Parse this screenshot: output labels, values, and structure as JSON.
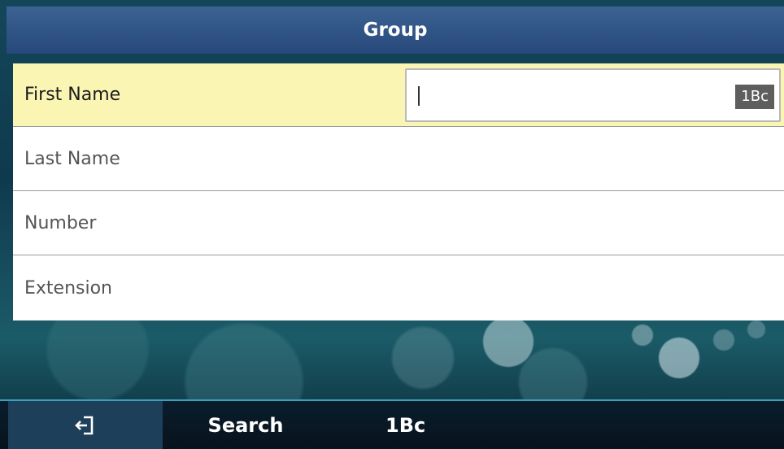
{
  "header": {
    "title": "Group"
  },
  "form": {
    "fields": [
      {
        "label": "First Name",
        "value": "",
        "input_mode": "1Bc"
      },
      {
        "label": "Last Name"
      },
      {
        "label": "Number"
      },
      {
        "label": "Extension"
      }
    ]
  },
  "softkeys": {
    "back_icon": "back-arrow-icon",
    "search_label": "Search",
    "input_mode_label": "1Bc"
  }
}
